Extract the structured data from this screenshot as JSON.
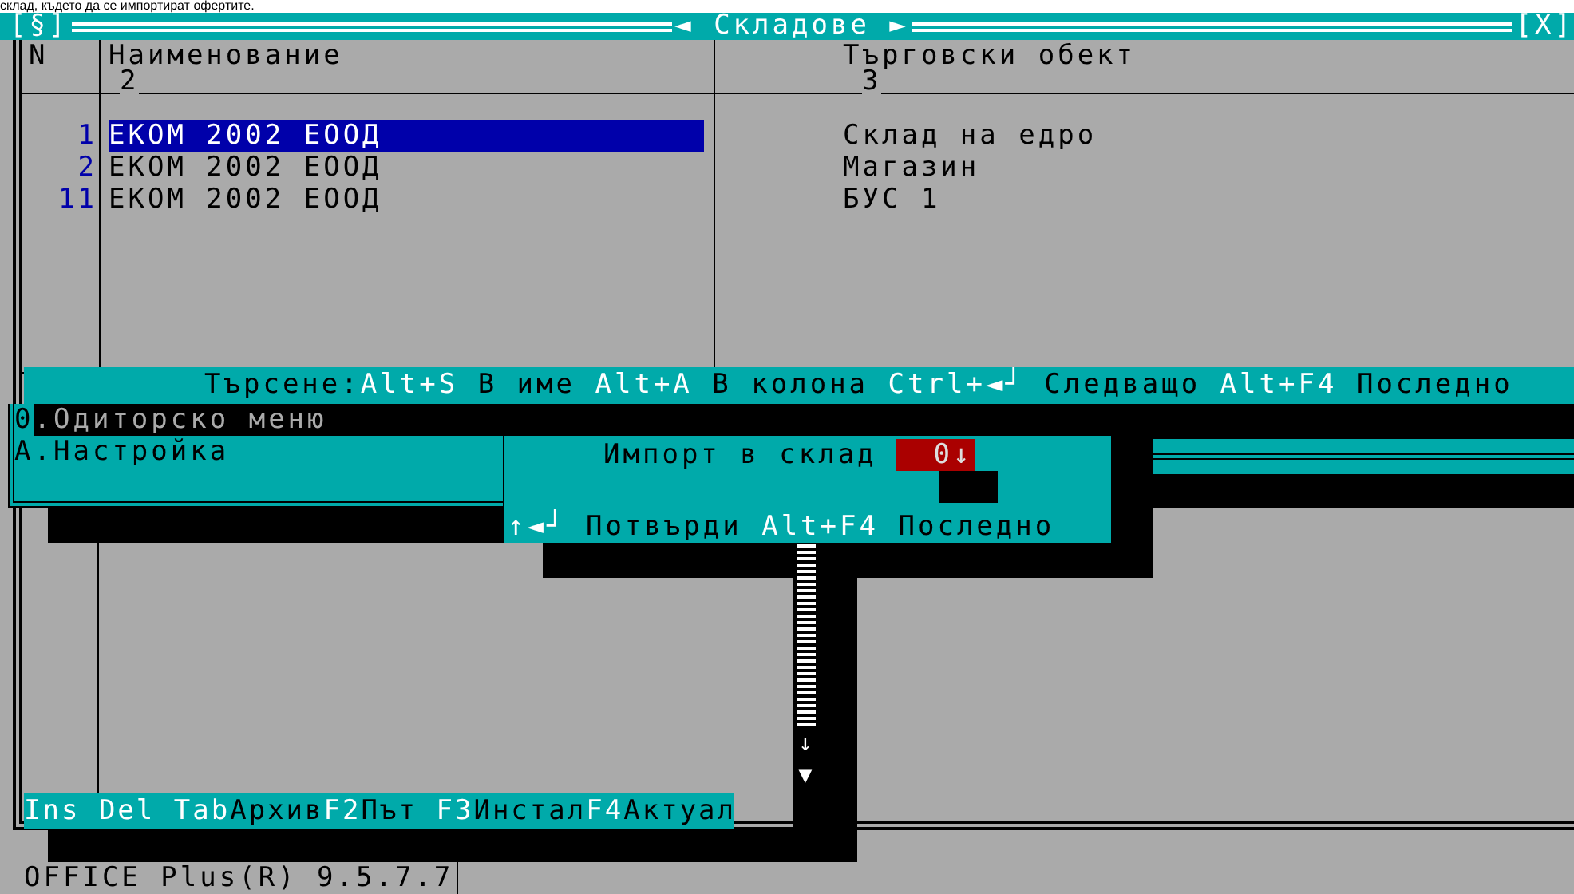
{
  "caption": "склад, където да се импортират офертите.",
  "window": {
    "system_button": "[§]",
    "title": "◄ Складове ►",
    "close_button": "[X]"
  },
  "table": {
    "columns": [
      {
        "label": "N"
      },
      {
        "label": "Наименование",
        "number": "2"
      },
      {
        "label": "Търговски обект",
        "number": "3"
      }
    ],
    "rows": [
      {
        "n": "1",
        "name": "ЕКОМ 2002 ЕООД",
        "site": "Склад на едро",
        "selected": true
      },
      {
        "n": "2",
        "name": "ЕКОМ 2002 ЕООД",
        "site": "Магазин",
        "selected": false
      },
      {
        "n": "11",
        "name": "ЕКОМ 2002 ЕООД",
        "site": "БУС 1",
        "selected": false
      }
    ]
  },
  "search_hint": [
    {
      "kind": "label",
      "text": "Търсене:"
    },
    {
      "kind": "key",
      "text": "Alt+S"
    },
    {
      "kind": "label",
      "text": " В име "
    },
    {
      "kind": "key",
      "text": "Alt+A"
    },
    {
      "kind": "label",
      "text": " В колона "
    },
    {
      "kind": "key",
      "text": "Ctrl+◄┘"
    },
    {
      "kind": "label",
      "text": " Следващо "
    },
    {
      "kind": "key",
      "text": "Alt+F4"
    },
    {
      "kind": "label",
      "text": " Последно"
    }
  ],
  "menu": [
    {
      "hotkey": "0",
      "label": ".Одиторско меню",
      "selected": true
    },
    {
      "hotkey": "А",
      "label": ".Настройка",
      "selected": false
    }
  ],
  "dialog": {
    "label": "Импорт в склад",
    "field_value": "0",
    "field_arrow": "↓",
    "footer": [
      {
        "kind": "key",
        "text": "↑◄┘"
      },
      {
        "kind": "label",
        "text": " Потвърди "
      },
      {
        "kind": "key",
        "text": "Alt+F4"
      },
      {
        "kind": "label",
        "text": " Последно"
      }
    ]
  },
  "scrollbar": {
    "arrows": [
      "↓",
      "▼"
    ]
  },
  "key_bar": [
    {
      "kind": "key",
      "text": "Ins Del Tab"
    },
    {
      "kind": "label",
      "text": "Архив"
    },
    {
      "kind": "key",
      "text": "F2"
    },
    {
      "kind": "label",
      "text": "Път "
    },
    {
      "kind": "key",
      "text": "F3"
    },
    {
      "kind": "label",
      "text": "Инстал"
    },
    {
      "kind": "key",
      "text": "F4"
    },
    {
      "kind": "label",
      "text": "Актуал"
    }
  ],
  "status": "OFFICE Plus(R) 9.5.7.7"
}
